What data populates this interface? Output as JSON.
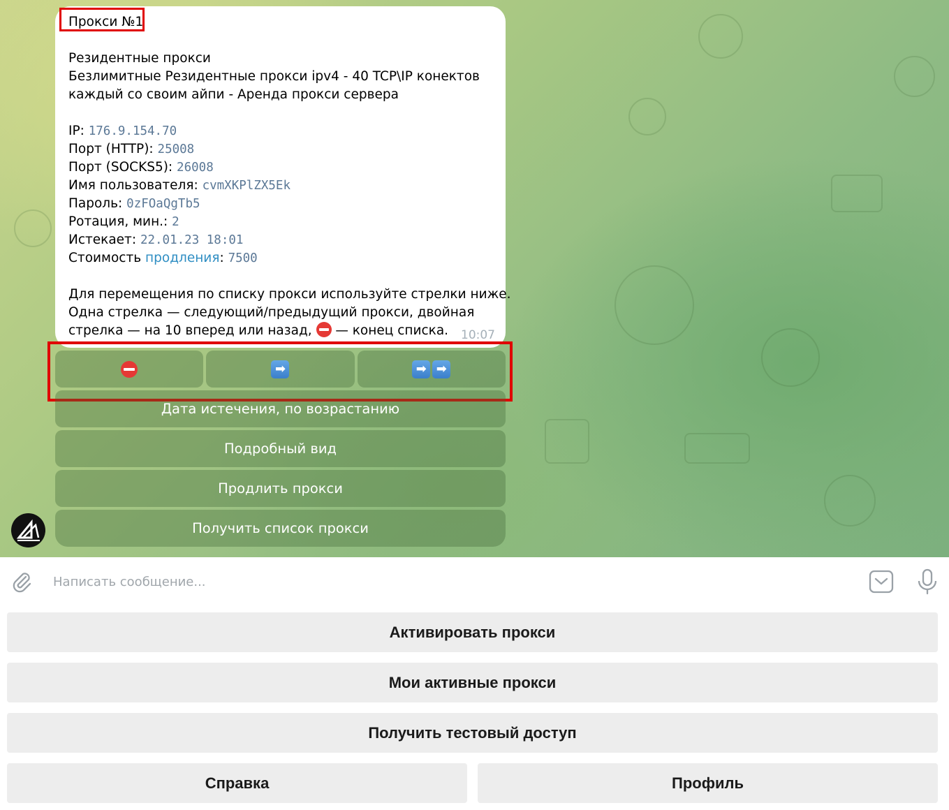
{
  "message": {
    "title": "Прокси №1",
    "type_line": "Резидентные прокси",
    "desc_line1": "Безлимитные Резидентные прокси ipv4 - 40 TCP\\IP конектов",
    "desc_line2": "каждый со своим айпи - Аренда прокси сервера",
    "ip_label": "IP: ",
    "ip_value": "176.9.154.70",
    "http_label": "Порт (HTTP): ",
    "http_value": "25008",
    "socks_label": "Порт (SOCKS5): ",
    "socks_value": "26008",
    "user_label": "Имя пользователя: ",
    "user_value": "cvmXKPlZX5Ek",
    "pass_label": "Пароль: ",
    "pass_value": "0zFOaQgTb5",
    "rotation_label": "Ротация, мин.: ",
    "rotation_value": "2",
    "expires_label": "Истекает: ",
    "expires_value": "22.01.23 18:01",
    "cost_label": "Стоимость ",
    "cost_link": "продления",
    "cost_sep": ": ",
    "cost_value": "7500",
    "help_line1": "Для перемещения по списку прокси используйте стрелки ниже.",
    "help_line2": "Одна стрелка — следующий/предыдущий прокси, двойная",
    "help_line3a": "стрелка — на 10 вперед или назад, ",
    "help_line3b": " — конец списка.",
    "time": "10:07"
  },
  "inline_keyboard": {
    "nav_next_arrow": "➡",
    "nav_next10_arrow_1": "➡",
    "nav_next10_arrow_2": "➡",
    "sort_label": "Дата истечения, по возрастанию",
    "detail_label": "Подробный вид",
    "extend_label": "Продлить прокси",
    "list_label": "Получить список прокси"
  },
  "compose": {
    "placeholder": "Написать сообщение..."
  },
  "reply_keyboard": {
    "activate": "Активировать прокси",
    "my_active": "Мои активные прокси",
    "test_access": "Получить тестовый доступ",
    "help": "Справка",
    "profile": "Профиль"
  },
  "colors": {
    "mono_text": "#5b7896",
    "link": "#2f8ec3",
    "highlight_box": "#e00000"
  }
}
